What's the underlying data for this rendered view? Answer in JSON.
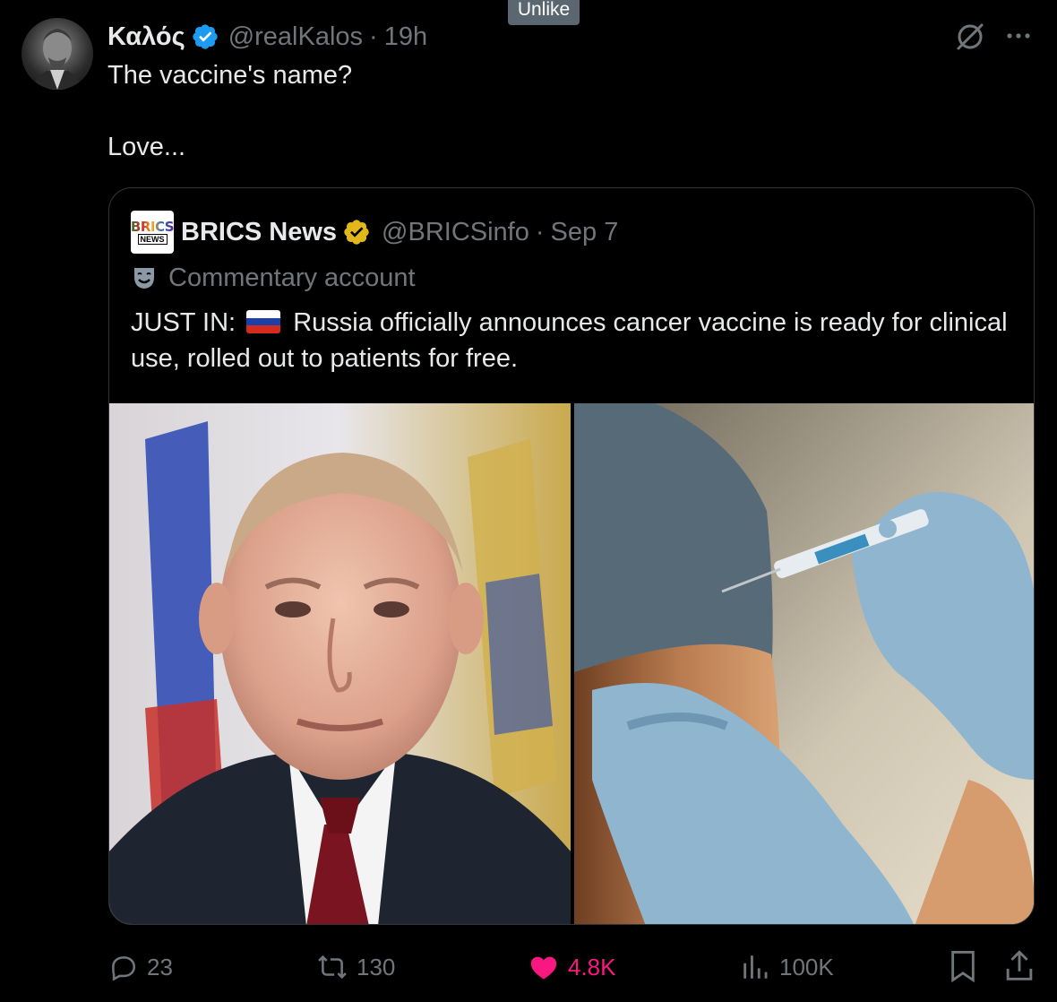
{
  "tooltip": "Unlike",
  "author": {
    "display_name": "Καλός",
    "handle": "@realKalos",
    "separator": "·",
    "time": "19h"
  },
  "tweet": {
    "line1": "The vaccine's name?",
    "line2": "Love..."
  },
  "quote": {
    "logo_top": "BRICS",
    "logo_bottom": "NEWS",
    "display_name": "BRICS News",
    "handle": "@BRICSinfo",
    "separator": "·",
    "time": "Sep 7",
    "label": "Commentary account",
    "text_prefix": "JUST IN:",
    "text_body": "Russia officially announces cancer vaccine is ready for clinical use, rolled out to patients for free.",
    "media": [
      "portrait photo",
      "vaccination photo"
    ]
  },
  "actions": {
    "replies": "23",
    "reposts": "130",
    "likes": "4.8K",
    "views": "100K"
  },
  "colors": {
    "background": "#000000",
    "text_primary": "#e7e9ea",
    "text_secondary": "#71767b",
    "verified_blue": "#1d9bf0",
    "verified_gold": "#e2b719",
    "like_pink": "#f91880",
    "border": "#333639"
  },
  "icons": [
    "verified-badge-icon",
    "grok-icon",
    "more-icon",
    "mask-icon",
    "flag-russia-icon",
    "reply-icon",
    "repost-icon",
    "heart-icon",
    "views-icon",
    "bookmark-icon",
    "share-icon"
  ]
}
